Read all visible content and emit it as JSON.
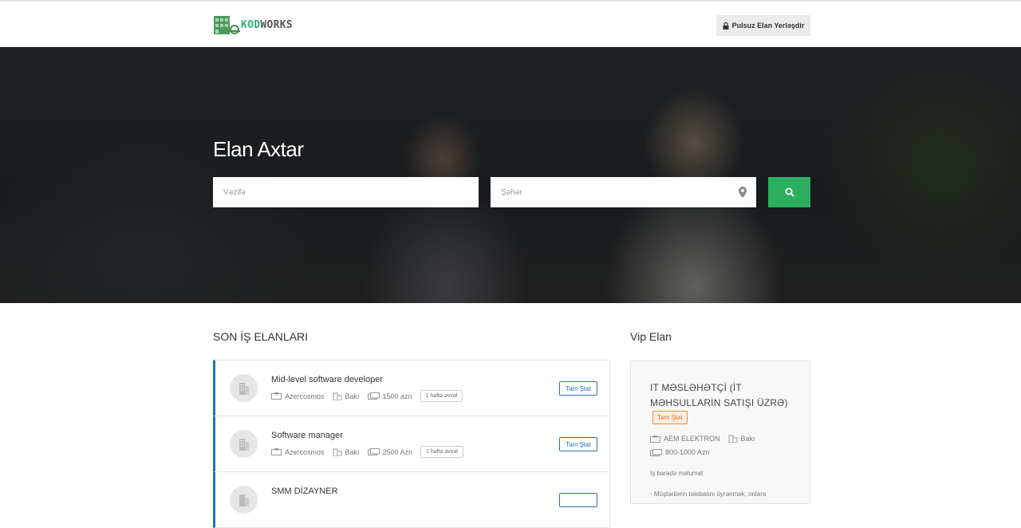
{
  "header": {
    "logo_text_a": "KOD",
    "logo_text_b": "WORKS",
    "post_button_label": "Pulsuz Elan Yerləşdir"
  },
  "hero": {
    "title": "Elan Axtar",
    "job_placeholder": "Vəzifə",
    "city_placeholder": "Şəhər"
  },
  "jobs": {
    "title": "SON İŞ ELANLARI",
    "items": [
      {
        "title": "Mid-level software developer",
        "company": "Azercosmos",
        "city": "Bakı",
        "salary": "1500 azn",
        "age": "1 həftə əvvəl",
        "type": "Tam Ştat"
      },
      {
        "title": "Software manager",
        "company": "Azercosmos",
        "city": "Bakı",
        "salary": "2500 Azn",
        "age": "1 həftə əvvəl",
        "type": "Tam Ştat"
      },
      {
        "title": "SMM DİZAYNER",
        "company": "",
        "city": "",
        "salary": "",
        "age": "",
        "type": ""
      }
    ]
  },
  "vip": {
    "title": "Vip Elan",
    "job_title": "IT MƏSLƏHƏTÇİ (İT MƏHSULLARIN SATIŞI ÜZRƏ)",
    "type": "Tam Ştat",
    "company": "AEM ELEKTRON",
    "city": "Bakı",
    "salary": "800-1000 Azn",
    "about_label": "İş barədə məlumat",
    "desc": "- Müştərilərin tələbatını öyrənmək, onlara"
  },
  "colors": {
    "accent_green": "#2eaf5f",
    "job_border_blue": "#1e73be",
    "vip_badge_orange": "#e0702a"
  }
}
